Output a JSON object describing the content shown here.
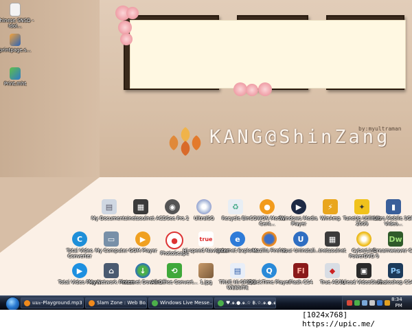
{
  "wallpaper": {
    "banner_text": "KANG@ShinZang",
    "byline": "by:myultraman"
  },
  "desktop_icons_left": [
    {
      "label": "Chinese SNSD - Idol...",
      "icon": "folder-icon"
    },
    {
      "label": "printpage.s...",
      "icon": "firefox-document-icon"
    },
    {
      "label": "Print.mht",
      "icon": "mht-document-icon"
    }
  ],
  "desktop_icons": [
    {
      "label": "My Documents",
      "icon": "my-documents-icon"
    },
    {
      "label": "Inetsoulnet",
      "icon": "network-app-icon"
    },
    {
      "label": "ACDSee Pro 2",
      "icon": "acdsee-icon"
    },
    {
      "label": "UltraISO",
      "icon": "disc-icon"
    },
    {
      "label": "Recycle Bin",
      "icon": "recycle-bin-icon"
    },
    {
      "label": "COWON Media Cent...",
      "icon": "cowon-icon"
    },
    {
      "label": "Windows Media Player",
      "icon": "media-player-icon"
    },
    {
      "label": "WinAmp",
      "icon": "winamp-icon"
    },
    {
      "label": "TuneUp Utilities 2009",
      "icon": "tuneup-icon"
    },
    {
      "label": "Ultra Mobile 3GP Video...",
      "icon": "phone-video-icon"
    },
    {
      "label": "Total Video Converter",
      "icon": "video-converter-icon"
    },
    {
      "label": "My Computer",
      "icon": "my-computer-icon"
    },
    {
      "label": "GOM Player",
      "icon": "gom-player-icon"
    },
    {
      "label": "PhotoScape",
      "icon": "photoscape-icon"
    },
    {
      "label": "Hi-speed Navigator",
      "icon": "true-navigator-icon"
    },
    {
      "label": "Internet Explorer",
      "icon": "internet-explorer-icon"
    },
    {
      "label": "Mozilla Firefox",
      "icon": "firefox-icon"
    },
    {
      "label": "Your Uninstall...",
      "icon": "uninstaller-icon"
    },
    {
      "label": "Inetsoulnet",
      "icon": "network-app-icon"
    },
    {
      "label": "CyberLink PowerDVD 9",
      "icon": "powerdvd-icon"
    },
    {
      "label": "Dreamweaver CS4",
      "icon": "dreamweaver-icon"
    },
    {
      "label": "Total Video Player",
      "icon": "video-player-icon"
    },
    {
      "label": "My Network Places",
      "icon": "network-places-icon"
    },
    {
      "label": "Internet Downlo...",
      "icon": "download-manager-icon"
    },
    {
      "label": "All Office Convert...",
      "icon": "office-converter-icon"
    },
    {
      "label": "1.jpg",
      "icon": "image-file-icon"
    },
    {
      "label": "TRUE HI-SPEED WEBSITE",
      "icon": "website-shortcut-icon"
    },
    {
      "label": "QuickTime Player",
      "icon": "quicktime-icon"
    },
    {
      "label": "Flash CS4",
      "icon": "flash-icon"
    },
    {
      "label": "True AD3L",
      "icon": "true-adsl-icon"
    },
    {
      "label": "Ulead VideoStud...",
      "icon": "videostudio-icon"
    },
    {
      "label": "Photoshop CS4",
      "icon": "photoshop-icon"
    }
  ],
  "taskbar": {
    "tasks": [
      {
        "label": "แมะ-Playground.mp3 ...",
        "icon": "firefox-icon"
      },
      {
        "label": "Slam Zone : Web Bo...",
        "icon": "firefox-icon"
      },
      {
        "label": "Windows Live Messe...",
        "icon": "messenger-icon"
      },
      {
        "label": "♥.๑.●.๑.☆ ฿️.☆.๑.●.๑.♥",
        "icon": "chat-window-icon"
      }
    ],
    "clock_time": "8:34",
    "clock_period": "PM"
  },
  "watermark": "[1024x768] https://upic.me/",
  "colors": {
    "wall": "#d8c0a8",
    "floor": "#fbf0e6",
    "canvas": "#fff8e2",
    "taskbar": "#101827"
  }
}
